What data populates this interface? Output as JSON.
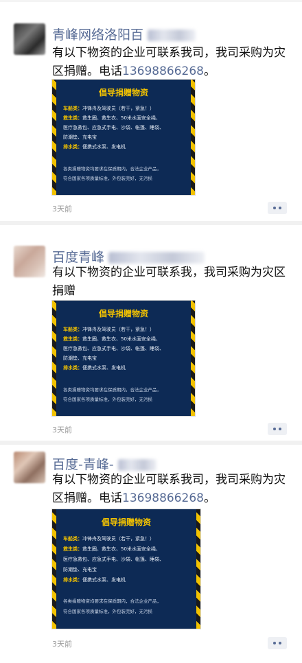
{
  "posts": [
    {
      "name": "青峰网络洛阳百",
      "text_before": "有以下物资的企业可联系我司，我司采购为灾区捐赠。电话",
      "phone": "13698866268",
      "text_after": "。",
      "poster": {
        "title": "倡导捐赠物资",
        "l1_label": "车船类：",
        "l1_text": "冲锋舟及驾驶员（若干，紧急！）",
        "l2_label": "救生类：",
        "l2_text": "救生圈、救生衣、50米水面安全绳、",
        "l3": "医疗急救包、应急式手电、沙袋、帐篷、睡袋、",
        "l4": "防潮垫、充电宝",
        "l5_label": "排水类：",
        "l5_text": "便携式水泵、发电机",
        "n1": "各类捐赠物资均要求在保质期内，合法企业产品，",
        "n2": "符合国家各项质量标准，外包装完好，无污损"
      },
      "time": "3天前"
    },
    {
      "name": "百度青峰",
      "text_before": "有以下物资的企业可联系我，我司采购为灾区捐赠",
      "phone": "",
      "text_after": "",
      "poster": {
        "title": "倡导捐赠物资",
        "l1_label": "车船类：",
        "l1_text": "冲锋舟及驾驶员（若干，紧急！）",
        "l2_label": "救生类：",
        "l2_text": "救生圈、救生衣、50米水面安全绳、",
        "l3": "医疗急救包、应急式手电、沙袋、帐篷、睡袋、",
        "l4": "防潮垫、充电宝",
        "l5_label": "排水类：",
        "l5_text": "便携式水泵、发电机",
        "n1": "各类捐赠物资均要求在保质期内，合法企业产品，",
        "n2": "符合国家各项质量标准，外包装完好，无污损"
      },
      "time": "3天前"
    },
    {
      "name": "百度-青峰-",
      "text_before": "有以下物资的企业可联系我司，我司采购为灾区捐赠。电话",
      "phone": "13698866268",
      "text_after": "。",
      "poster": {
        "title": "倡导捐赠物资",
        "l1_label": "车船类：",
        "l1_text": "冲锋舟及驾驶员（若干，紧急！）",
        "l2_label": "救生类：",
        "l2_text": "救生圈、救生衣、50米水面安全绳、",
        "l3": "医疗急救包、应急式手电、沙袋、帐篷、睡袋、",
        "l4": "防潮垫、充电宝",
        "l5_label": "排水类：",
        "l5_text": "便携式水泵、发电机",
        "n1": "各类捐赠物资均要求在保质期内，合法企业产品，",
        "n2": "符合国家各项质量标准，外包装完好，无污损"
      },
      "time": "3天前"
    }
  ],
  "colors": {
    "link": "#576b95",
    "poster_bg": "#0d2a55",
    "poster_accent": "#f5c400"
  },
  "icons": {
    "more": "more-dots-icon"
  }
}
